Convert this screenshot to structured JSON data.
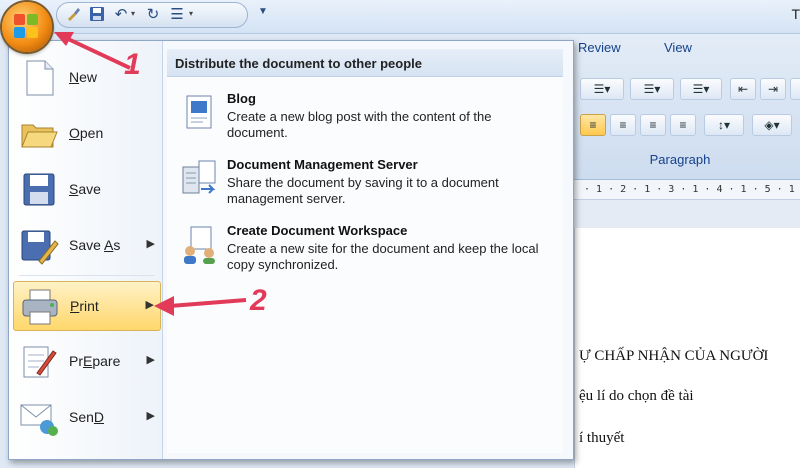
{
  "window": {
    "title": "T"
  },
  "qat": {
    "icons": [
      "brush-icon",
      "save-icon",
      "undo-icon",
      "redo-icon",
      "format-icon"
    ]
  },
  "ribbon": {
    "tabs": [
      "Review",
      "View"
    ],
    "group_label": "Paragraph",
    "ruler": "· 1 · 2 · 1 · 3 · 1 · 4 · 1 · 5 · 1"
  },
  "document": {
    "lines": [
      "Ự CHẤP NHẬN CỦA NGƯỜI",
      "ệu lí do chọn đề tài",
      "í thuyết"
    ]
  },
  "menu": {
    "items": [
      {
        "label": "New",
        "accel": "N",
        "rest": "ew",
        "icon": "new-document-icon",
        "submenu": false
      },
      {
        "label": "Open",
        "accel": "O",
        "rest": "pen",
        "icon": "open-folder-icon",
        "submenu": false
      },
      {
        "label": "Save",
        "accel": "S",
        "rest": "ave",
        "icon": "save-icon",
        "submenu": false
      },
      {
        "label": "Save As",
        "accel": "A",
        "pre": "Save ",
        "rest": "s",
        "icon": "save-as-icon",
        "submenu": true
      },
      {
        "label": "Print",
        "accel": "P",
        "rest": "rint",
        "icon": "printer-icon",
        "submenu": true
      },
      {
        "label": "Prepare",
        "accel": "E",
        "pre": "Pr",
        "rest": "pare",
        "icon": "prepare-icon",
        "submenu": true
      },
      {
        "label": "Send",
        "accel": "D",
        "pre": "Sen",
        "rest": "",
        "icon": "send-icon",
        "submenu": true
      }
    ],
    "panel": {
      "heading": "Distribute the document to other people",
      "options": [
        {
          "title": "Blog",
          "desc": "Create a new blog post with the content of the document.",
          "icon": "blog-icon"
        },
        {
          "title": "Document Management Server",
          "desc": "Share the document by saving it to a document management server.",
          "icon": "server-icon"
        },
        {
          "title": "Create Document Workspace",
          "desc": "Create a new site for the document and keep the local copy synchronized.",
          "icon": "workspace-icon"
        }
      ]
    }
  },
  "annotations": {
    "step1": "1",
    "step2": "2"
  },
  "colors": {
    "annotation": "#e23b5a",
    "highlight": "#ffd76b",
    "ribbon_text": "#15428b"
  }
}
